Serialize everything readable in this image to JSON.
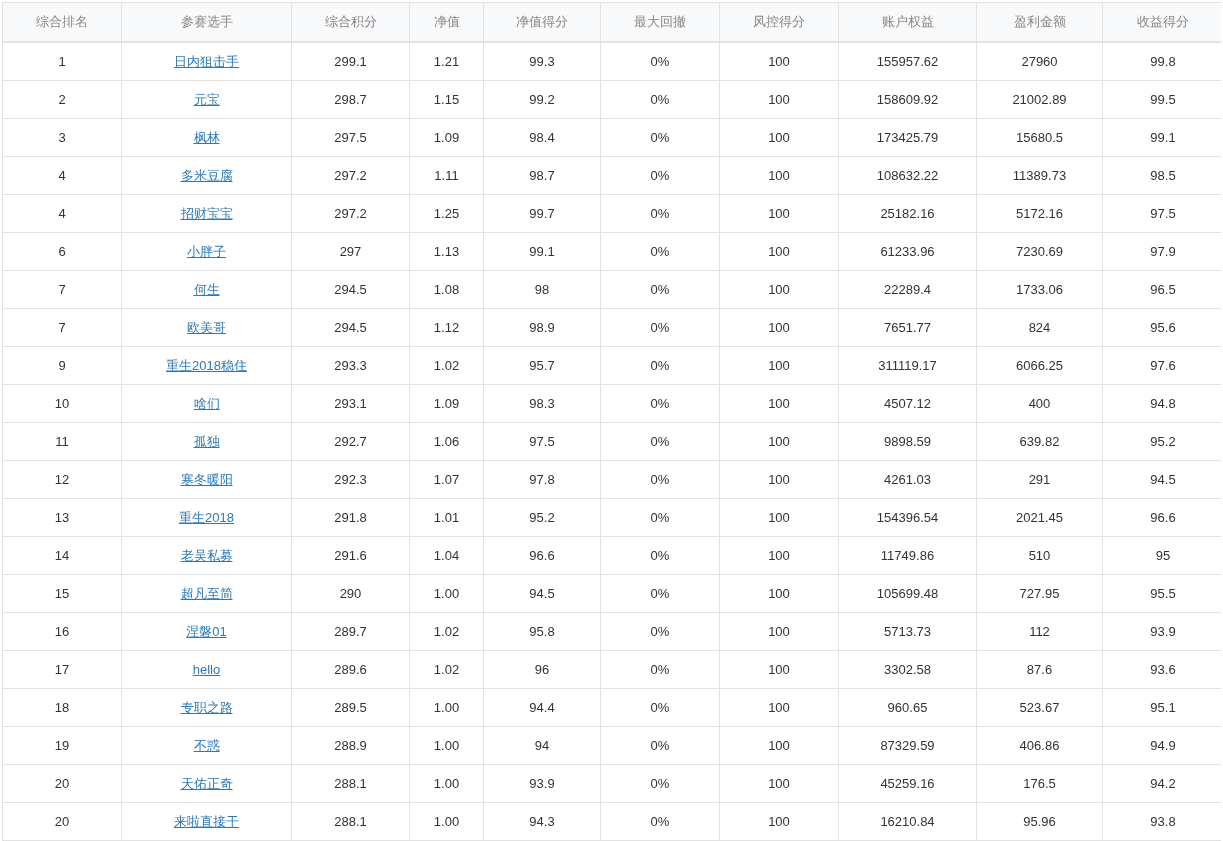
{
  "table": {
    "columns": [
      "综合排名",
      "参赛选手",
      "综合积分",
      "净值",
      "净值得分",
      "最大回撤",
      "风控得分",
      "账户权益",
      "盈利金额",
      "收益得分"
    ],
    "rows": [
      [
        "1",
        "日内狙击手",
        "299.1",
        "1.21",
        "99.3",
        "0%",
        "100",
        "155957.62",
        "27960",
        "99.8"
      ],
      [
        "2",
        "元宝",
        "298.7",
        "1.15",
        "99.2",
        "0%",
        "100",
        "158609.92",
        "21002.89",
        "99.5"
      ],
      [
        "3",
        "枫林",
        "297.5",
        "1.09",
        "98.4",
        "0%",
        "100",
        "173425.79",
        "15680.5",
        "99.1"
      ],
      [
        "4",
        "多米豆腐",
        "297.2",
        "1.11",
        "98.7",
        "0%",
        "100",
        "108632.22",
        "11389.73",
        "98.5"
      ],
      [
        "4",
        "招财宝宝",
        "297.2",
        "1.25",
        "99.7",
        "0%",
        "100",
        "25182.16",
        "5172.16",
        "97.5"
      ],
      [
        "6",
        "小胖子",
        "297",
        "1.13",
        "99.1",
        "0%",
        "100",
        "61233.96",
        "7230.69",
        "97.9"
      ],
      [
        "7",
        "何生",
        "294.5",
        "1.08",
        "98",
        "0%",
        "100",
        "22289.4",
        "1733.06",
        "96.5"
      ],
      [
        "7",
        "欧美哥",
        "294.5",
        "1.12",
        "98.9",
        "0%",
        "100",
        "7651.77",
        "824",
        "95.6"
      ],
      [
        "9",
        "重生2018稳住",
        "293.3",
        "1.02",
        "95.7",
        "0%",
        "100",
        "311119.17",
        "6066.25",
        "97.6"
      ],
      [
        "10",
        "啥们",
        "293.1",
        "1.09",
        "98.3",
        "0%",
        "100",
        "4507.12",
        "400",
        "94.8"
      ],
      [
        "11",
        "孤独",
        "292.7",
        "1.06",
        "97.5",
        "0%",
        "100",
        "9898.59",
        "639.82",
        "95.2"
      ],
      [
        "12",
        "寒冬暖阳",
        "292.3",
        "1.07",
        "97.8",
        "0%",
        "100",
        "4261.03",
        "291",
        "94.5"
      ],
      [
        "13",
        "重生2018",
        "291.8",
        "1.01",
        "95.2",
        "0%",
        "100",
        "154396.54",
        "2021.45",
        "96.6"
      ],
      [
        "14",
        "老吴私募",
        "291.6",
        "1.04",
        "96.6",
        "0%",
        "100",
        "11749.86",
        "510",
        "95"
      ],
      [
        "15",
        "超凡至简",
        "290",
        "1.00",
        "94.5",
        "0%",
        "100",
        "105699.48",
        "727.95",
        "95.5"
      ],
      [
        "16",
        "涅磐01",
        "289.7",
        "1.02",
        "95.8",
        "0%",
        "100",
        "5713.73",
        "112",
        "93.9"
      ],
      [
        "17",
        "hello",
        "289.6",
        "1.02",
        "96",
        "0%",
        "100",
        "3302.58",
        "87.6",
        "93.6"
      ],
      [
        "18",
        "专职之路",
        "289.5",
        "1.00",
        "94.4",
        "0%",
        "100",
        "960.65",
        "523.67",
        "95.1"
      ],
      [
        "19",
        "不惑",
        "288.9",
        "1.00",
        "94",
        "0%",
        "100",
        "87329.59",
        "406.86",
        "94.9"
      ],
      [
        "20",
        "天佑正奇",
        "288.1",
        "1.00",
        "93.9",
        "0%",
        "100",
        "45259.16",
        "176.5",
        "94.2"
      ],
      [
        "20",
        "来啦直接干",
        "288.1",
        "1.00",
        "94.3",
        "0%",
        "100",
        "16210.84",
        "95.96",
        "93.8"
      ]
    ]
  }
}
